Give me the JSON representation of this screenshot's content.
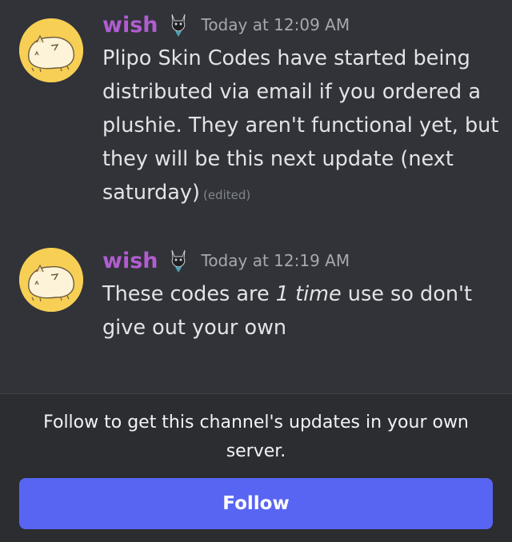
{
  "messages": [
    {
      "username": "wish",
      "timestamp": "Today at 12:09 AM",
      "text": "Plipo Skin Codes have started being distributed via email if you ordered a plushie. They aren't functional yet, but they will be this next update (next saturday)",
      "edited_label": "(edited)"
    },
    {
      "username": "wish",
      "timestamp": "Today at 12:19 AM",
      "text_before": "These codes are ",
      "text_emphasis": "1 time",
      "text_after": " use so don't give out your own"
    }
  ],
  "footer": {
    "text": "Follow to get this channel's updates in your own server.",
    "button_label": "Follow"
  },
  "colors": {
    "background": "#313338",
    "footer_background": "#2b2d31",
    "username": "#b05dd0",
    "button": "#5865f2",
    "avatar": "#f7cf54"
  },
  "icons": {
    "avatar": "hamster-avatar-icon",
    "badge": "cat-badge-icon"
  }
}
